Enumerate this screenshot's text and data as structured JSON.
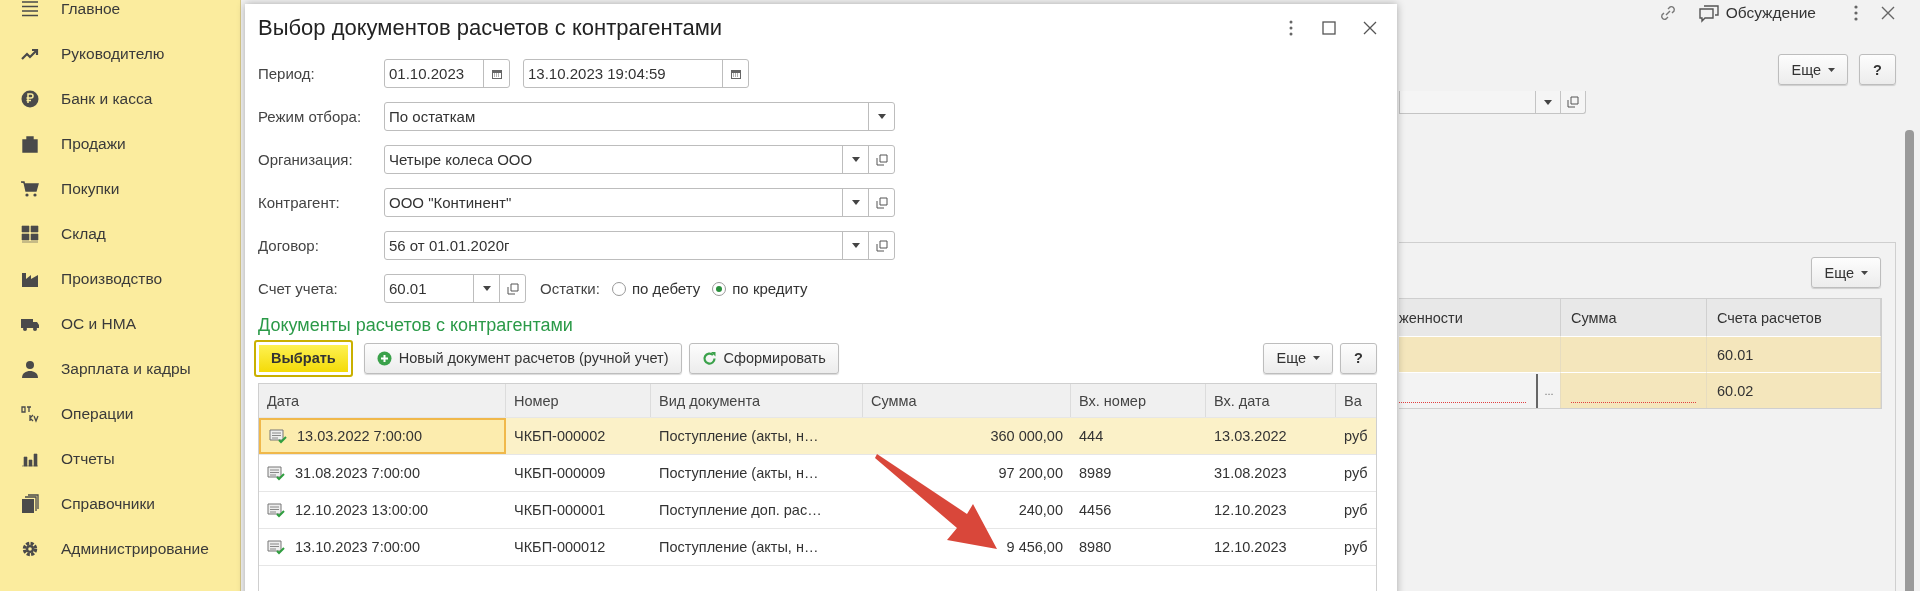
{
  "sidebar": {
    "items": [
      {
        "label": "Главное"
      },
      {
        "label": "Руководителю"
      },
      {
        "label": "Банк и касса"
      },
      {
        "label": "Продажи"
      },
      {
        "label": "Покупки"
      },
      {
        "label": "Склад"
      },
      {
        "label": "Производство"
      },
      {
        "label": "ОС и НМА"
      },
      {
        "label": "Зарплата и кадры"
      },
      {
        "label": "Операции"
      },
      {
        "label": "Отчеты"
      },
      {
        "label": "Справочники"
      },
      {
        "label": "Администрирование"
      }
    ]
  },
  "background_form": {
    "discussion": "Обсуждение",
    "more_button": "Еще",
    "help_button": "?",
    "table": {
      "more_button": "Еще",
      "columns": [
        "женности",
        "Сумма",
        "Счета расчетов"
      ],
      "rows": [
        {
          "account": "60.01"
        },
        {
          "account": "60.02",
          "choice_button": "..."
        }
      ]
    }
  },
  "dialog": {
    "title": "Выбор документов расчетов с контрагентами",
    "period": {
      "label": "Период:",
      "from": "01.10.2023",
      "to": "13.10.2023 19:04:59"
    },
    "selects": [
      {
        "label": "Режим отбора:",
        "value": "По остаткам",
        "open_button": false
      },
      {
        "label": "Организация:",
        "value": "Четыре колеса ООО",
        "open_button": true
      },
      {
        "label": "Контрагент:",
        "value": "ООО \"Континент\"",
        "open_button": true
      },
      {
        "label": "Договор:",
        "value": "56 от 01.01.2020г",
        "open_button": true
      }
    ],
    "account": {
      "label": "Счет учета:",
      "value": "60.01"
    },
    "balances": {
      "label": "Остатки:",
      "options": [
        {
          "label": "по дебету",
          "selected": false
        },
        {
          "label": "по кредиту",
          "selected": true
        }
      ]
    },
    "section_title": "Документы расчетов с контрагентами",
    "toolbar": {
      "buttons": [
        {
          "label": "Выбрать",
          "kind": "default",
          "highlighted": true
        },
        {
          "label": "Новый документ расчетов (ручной учет)",
          "kind": "add",
          "highlighted": false
        },
        {
          "label": "Сформировать",
          "kind": "refresh",
          "highlighted": false
        }
      ],
      "more_button": "Еще",
      "help_button": "?"
    },
    "table": {
      "columns": [
        "Дата",
        "Номер",
        "Вид документа",
        "Сумма",
        "Вх. номер",
        "Вх. дата",
        "Ва"
      ],
      "rows": [
        {
          "selected": true,
          "cells": [
            "13.03.2022 7:00:00",
            "ЧКБП-000002",
            "Поступление (акты, н…",
            "360 000,00",
            "444",
            "13.03.2022",
            "руб"
          ]
        },
        {
          "selected": false,
          "cells": [
            "31.08.2023 7:00:00",
            "ЧКБП-000009",
            "Поступление (акты, н…",
            "97 200,00",
            "8989",
            "31.08.2023",
            "руб"
          ]
        },
        {
          "selected": false,
          "cells": [
            "12.10.2023 13:00:00",
            "ЧКБП-000001",
            "Поступление доп. рас…",
            "240,00",
            "4456",
            "12.10.2023",
            "руб"
          ]
        },
        {
          "selected": false,
          "cells": [
            "13.10.2023 7:00:00",
            "ЧКБП-000012",
            "Поступление (акты, н…",
            "9 456,00",
            "8980",
            "12.10.2023",
            "руб"
          ]
        }
      ]
    }
  }
}
